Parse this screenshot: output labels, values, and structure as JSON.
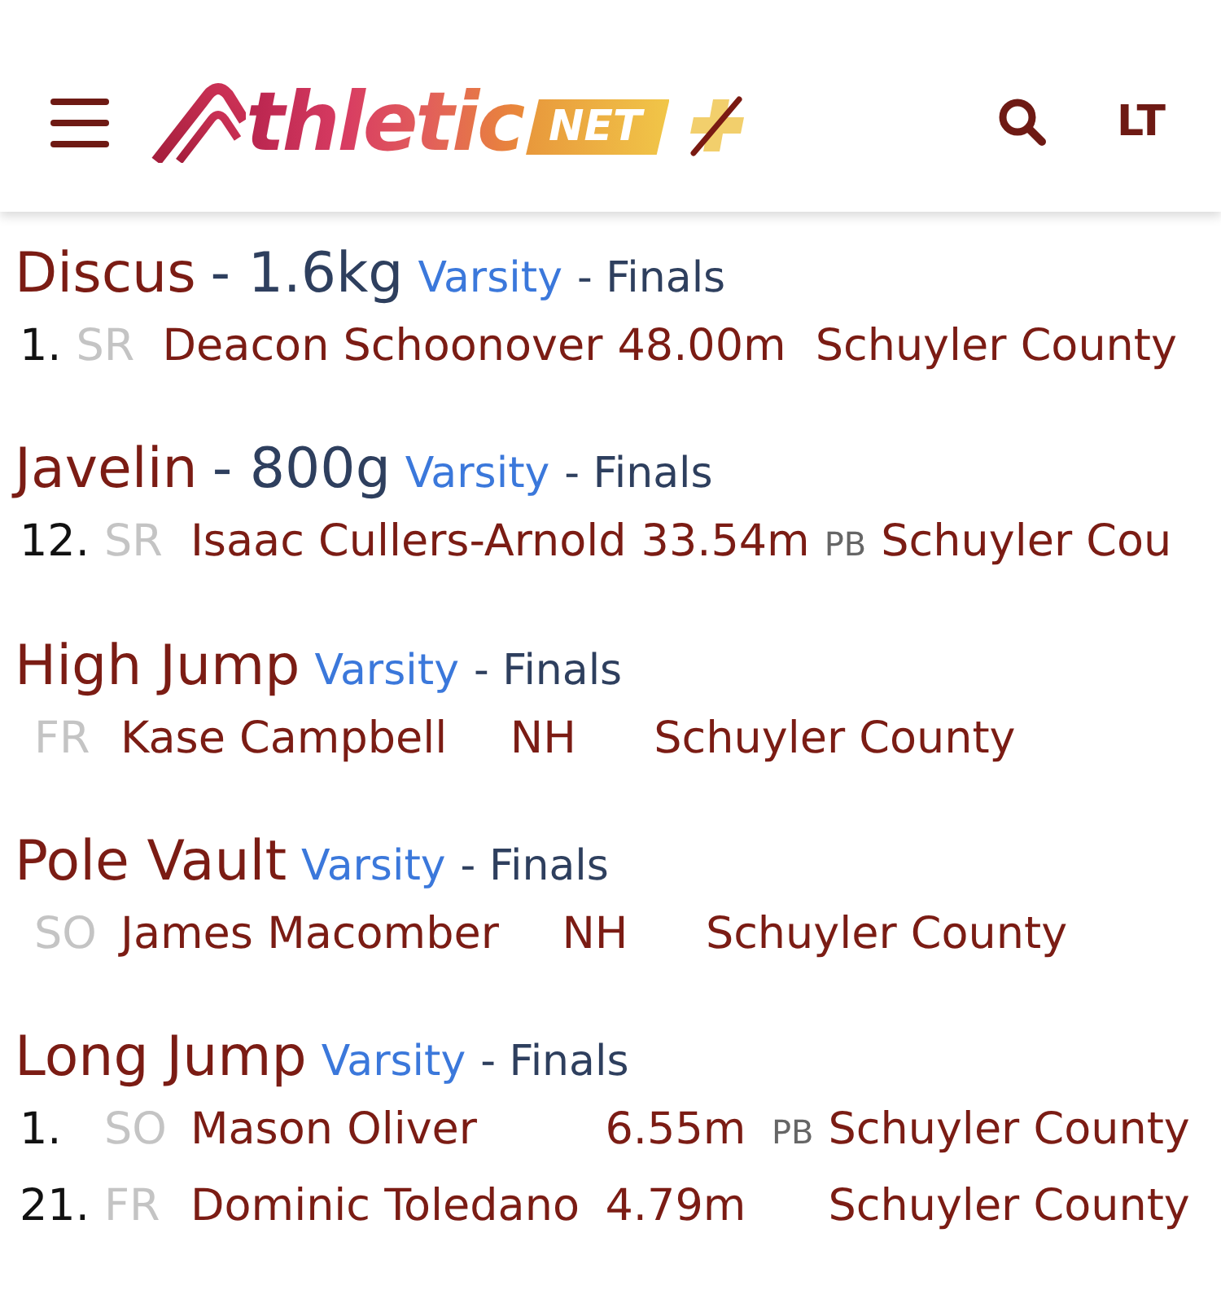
{
  "header": {
    "logo": {
      "wordmark": "thletic",
      "tag": "NET"
    },
    "account_initials": "LT"
  },
  "events": [
    {
      "name": "Discus",
      "spec": "- 1.6kg",
      "division": "Varsity",
      "round": "- Finals",
      "results": [
        {
          "place": "1.",
          "grade": "SR",
          "athlete": "Deacon Schoonover",
          "mark": "48.00m",
          "team": "Schuyler County"
        }
      ]
    },
    {
      "name": "Javelin",
      "spec": "- 800g",
      "division": "Varsity",
      "round": "- Finals",
      "results": [
        {
          "place": "12.",
          "grade": "SR",
          "athlete": "Isaac Cullers-Arnold",
          "mark": "33.54m",
          "note": "PB",
          "team": "Schuyler Cou"
        }
      ]
    },
    {
      "name": "High Jump",
      "division": "Varsity",
      "round": "- Finals",
      "results": [
        {
          "grade": "FR",
          "athlete": "Kase Campbell",
          "mark": "NH",
          "team": "Schuyler County"
        }
      ]
    },
    {
      "name": "Pole Vault",
      "division": "Varsity",
      "round": "- Finals",
      "results": [
        {
          "grade": "SO",
          "athlete": "James Macomber",
          "mark": "NH",
          "team": "Schuyler County"
        }
      ]
    },
    {
      "name": "Long Jump",
      "division": "Varsity",
      "round": "- Finals",
      "results": [
        {
          "place": "1.",
          "grade": "SO",
          "athlete": "Mason Oliver",
          "mark": "6.55m",
          "note": "PB",
          "team": "Schuyler County"
        },
        {
          "place": "21.",
          "grade": "FR",
          "athlete": "Dominic Toledano",
          "mark": "4.79m",
          "team": "Schuyler County"
        }
      ]
    }
  ]
}
